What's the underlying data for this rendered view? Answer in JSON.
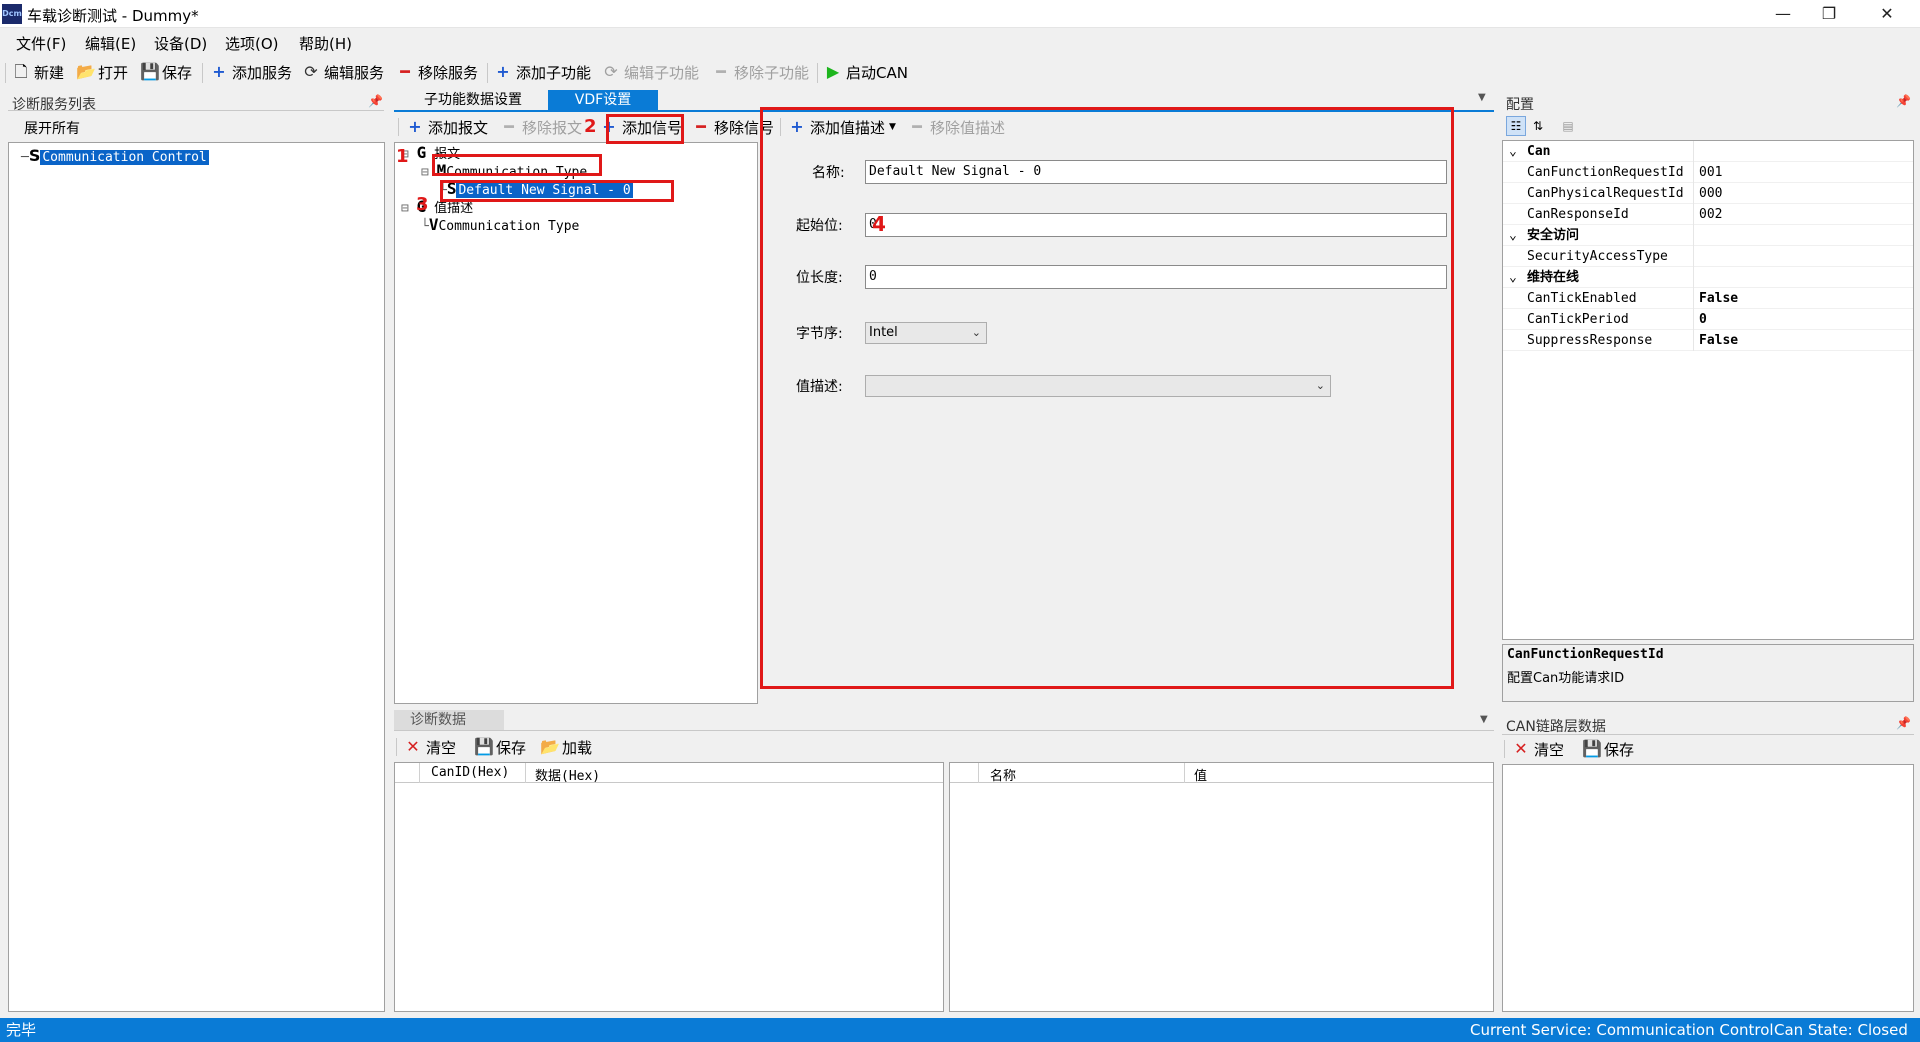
{
  "window": {
    "title": "车载诊断测试 - Dummy*",
    "icon_text": "Dcm",
    "minimize": "—",
    "restore": "❐",
    "close": "✕"
  },
  "menu": [
    "文件(F)",
    "编辑(E)",
    "设备(D)",
    "选项(O)",
    "帮助(H)"
  ],
  "toolbar": {
    "new": "新建",
    "open": "打开",
    "save": "保存",
    "add_service": "添加服务",
    "edit_service": "编辑服务",
    "remove_service": "移除服务",
    "add_subfunction": "添加子功能",
    "edit_subfunction": "编辑子功能",
    "remove_subfunction": "移除子功能",
    "start_can": "启动CAN"
  },
  "service_list": {
    "title": "诊断服务列表",
    "expand_all": "展开所有",
    "items": [
      {
        "prefix": "S",
        "label": "Communication Control"
      }
    ]
  },
  "tabs": [
    {
      "label": "子功能数据设置",
      "active": false
    },
    {
      "label": "VDF设置",
      "active": true
    }
  ],
  "vdf_toolbar": {
    "add_message": "添加报文",
    "remove_message": "移除报文",
    "add_signal": "添加信号",
    "remove_signal": "移除信号",
    "add_value_desc": "添加值描述",
    "remove_value_desc": "移除值描述"
  },
  "vdf_tree": {
    "messages_group": {
      "prefix": "G",
      "label": "报文"
    },
    "message": {
      "prefix": "M",
      "label": "Communication Type"
    },
    "signal": {
      "prefix": "S",
      "label": "Default New Signal - 0"
    },
    "valuedesc_group": {
      "prefix": "G",
      "label": "值描述"
    },
    "valuedesc": {
      "prefix": "V",
      "label": "Communication Type"
    }
  },
  "annotations": [
    "1",
    "2",
    "3",
    "4"
  ],
  "signal_form": {
    "name_label": "名称:",
    "name_value": "Default New Signal - 0",
    "start_bit_label": "起始位:",
    "start_bit_value": "0",
    "bit_length_label": "位长度:",
    "bit_length_value": "0",
    "byte_order_label": "字节序:",
    "byte_order_value": "Intel",
    "value_desc_label": "值描述:",
    "value_desc_value": ""
  },
  "config": {
    "title": "配置",
    "categories": [
      {
        "name": "Can",
        "props": [
          {
            "key": "CanFunctionRequestId",
            "value": "001"
          },
          {
            "key": "CanPhysicalRequestId",
            "value": "000"
          },
          {
            "key": "CanResponseId",
            "value": "002"
          }
        ]
      },
      {
        "name": "安全访问",
        "props": [
          {
            "key": "SecurityAccessType",
            "value": ""
          }
        ]
      },
      {
        "name": "维持在线",
        "props": [
          {
            "key": "CanTickEnabled",
            "value": "False"
          },
          {
            "key": "CanTickPeriod",
            "value": "0"
          },
          {
            "key": "SuppressResponse",
            "value": "False"
          }
        ]
      }
    ],
    "desc_title": "CanFunctionRequestId",
    "desc_text": "配置Can功能请求ID"
  },
  "diag_data": {
    "title": "诊断数据",
    "clear": "清空",
    "save": "保存",
    "load": "加载",
    "left_columns": [
      "CanID(Hex)",
      "数据(Hex)"
    ],
    "right_columns": [
      "名称",
      "值"
    ]
  },
  "can_link": {
    "title": "CAN链路层数据",
    "clear": "清空",
    "save": "保存"
  },
  "status": {
    "left": "完毕",
    "service": "Current Service: Communication Control",
    "can_state": "Can State: Closed"
  },
  "colors": {
    "accent": "#0a64c8",
    "status_bar": "#0a7bd6",
    "annotation_red": "#e01818",
    "start_green": "#1db51d"
  }
}
